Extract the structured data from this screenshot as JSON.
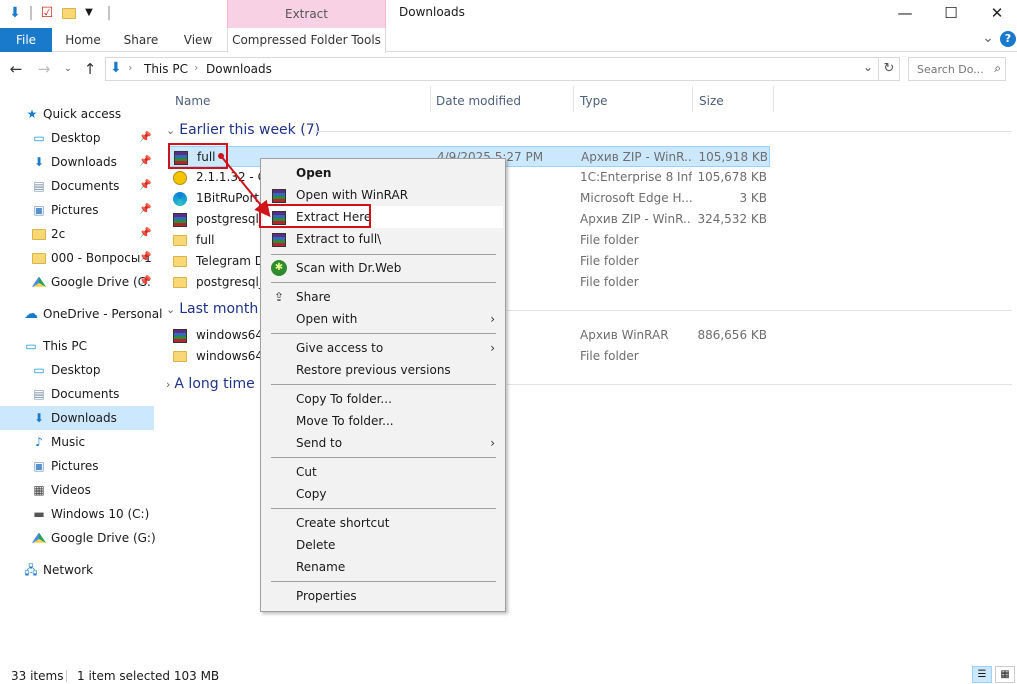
{
  "window": {
    "title": "Downloads",
    "contextual_group_label": "Extract",
    "minimize_glyph": "—",
    "maximize_glyph": "☐",
    "close_glyph": "✕"
  },
  "ribbon": {
    "file_tab": "File",
    "home_tab": "Home",
    "share_tab": "Share",
    "view_tab": "View",
    "contextual_tab": "Compressed Folder Tools",
    "collapse_glyph": "⌄",
    "help_glyph": "?"
  },
  "address_bar": {
    "segments": [
      "This PC",
      "Downloads"
    ],
    "separator": "›",
    "search_placeholder": "Search Do..."
  },
  "nav_pane": {
    "quick_access": "Quick access",
    "qa_items": [
      "Desktop",
      "Downloads",
      "Documents",
      "Pictures",
      "2c",
      "000 - Вопросы 1",
      "Google Drive (G:"
    ],
    "onedrive": "OneDrive - Personal",
    "this_pc": "This PC",
    "pc_items": [
      "Desktop",
      "Documents",
      "Downloads",
      "Music",
      "Pictures",
      "Videos",
      "Windows 10 (C:)",
      "Google Drive (G:)"
    ],
    "network": "Network"
  },
  "columns": {
    "name": "Name",
    "date": "Date modified",
    "type": "Type",
    "size": "Size"
  },
  "groups": {
    "earlier_this_week": "Earlier this week (7)",
    "last_month": "Last month (",
    "long_time_ago": "A long time"
  },
  "files": [
    {
      "name": "full",
      "date": "4/9/2025 5:27 PM",
      "type": "Архив ZIP - WinR...",
      "size": "105,918 KB",
      "icon": "winrar-icon"
    },
    {
      "name": "2.1.1.32 - Co",
      "date": "7 PM",
      "type": "1C:Enterprise 8 Inf...",
      "size": "105,678 KB",
      "icon": "1c-icon"
    },
    {
      "name": "1BitRuPortal",
      "date": "7 PM",
      "type": "Microsoft Edge H...",
      "size": "3 KB",
      "icon": "edge-icon"
    },
    {
      "name": "postgresql_1",
      "date": "PM",
      "type": "Архив ZIP - WinR...",
      "size": "324,532 KB",
      "icon": "winrar-icon"
    },
    {
      "name": "full",
      "date": "PM",
      "type": "File folder",
      "size": "",
      "icon": "folder-icon"
    },
    {
      "name": "Telegram De",
      "date": "3 PM",
      "type": "File folder",
      "size": "",
      "icon": "folder-icon"
    },
    {
      "name": "postgresql_1",
      "date": "3 AM",
      "type": "File folder",
      "size": "",
      "icon": "folder-icon"
    }
  ],
  "files_last_month": [
    {
      "name": "windows64f",
      "date": "9 PM",
      "type": "Архив WinRAR",
      "size": "886,656 KB",
      "icon": "winrar-icon"
    },
    {
      "name": "windows64f",
      "date": "21 PM",
      "type": "File folder",
      "size": "",
      "icon": "folder-icon"
    }
  ],
  "context_menu": {
    "open": "Open",
    "open_winrar": "Open with WinRAR",
    "extract_here": "Extract Here",
    "extract_to": "Extract to full\\",
    "scan_drweb": "Scan with Dr.Web",
    "share": "Share",
    "open_with": "Open with",
    "give_access": "Give access to",
    "restore_versions": "Restore previous versions",
    "copy_to_folder": "Copy To folder...",
    "move_to_folder": "Move To folder...",
    "send_to": "Send to",
    "cut": "Cut",
    "copy": "Copy",
    "create_shortcut": "Create shortcut",
    "delete": "Delete",
    "rename": "Rename",
    "properties": "Properties",
    "submenu_glyph": "›"
  },
  "status": {
    "item_count": "33 items",
    "selection": "1 item selected  103 MB"
  },
  "colors": {
    "accent": "#1979ca",
    "contextual": "#f9d1e5",
    "selection": "#cce8ff",
    "annotation_red": "#d0131b"
  }
}
